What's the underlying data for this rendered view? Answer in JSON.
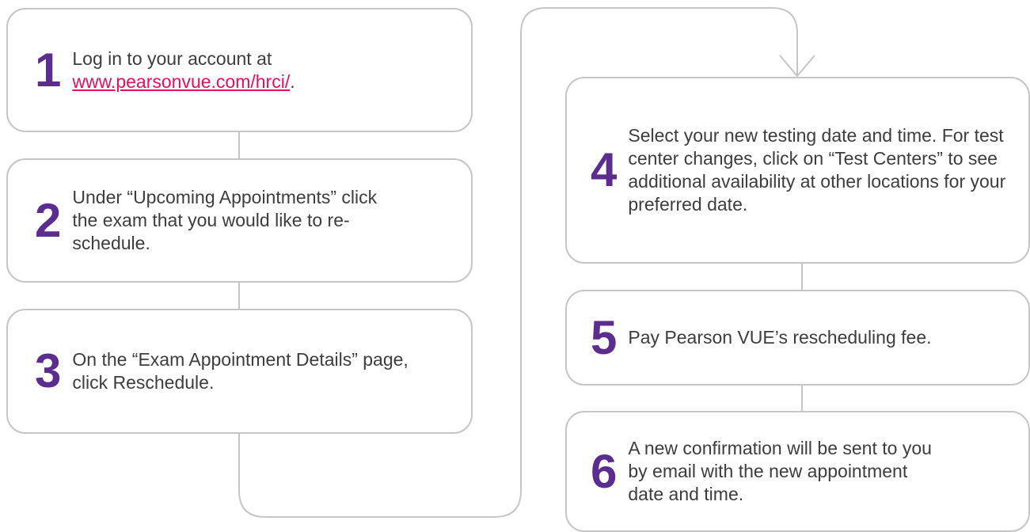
{
  "colors": {
    "number": "#5b2d8e",
    "link": "#e0115f",
    "border": "#c6c6c6",
    "text": "#3d3d3d"
  },
  "steps": [
    {
      "number": "1",
      "text": "Log in to your account at",
      "link": "www.pearsonvue.com/hrci/",
      "after_link": "."
    },
    {
      "number": "2",
      "text": "Under “Upcoming Appointments” click the exam that you would like to re-schedule."
    },
    {
      "number": "3",
      "text": "On the “Exam Appointment Details” page, click Reschedule."
    },
    {
      "number": "4",
      "text": "Select your new testing date and time. For test center changes, click on “Test Centers” to see additional availability at other locations for your preferred date."
    },
    {
      "number": "5",
      "text": "Pay Pearson VUE’s rescheduling fee."
    },
    {
      "number": "6",
      "text": "A new confirmation will be sent to you by email with the new appointment date and time."
    }
  ]
}
